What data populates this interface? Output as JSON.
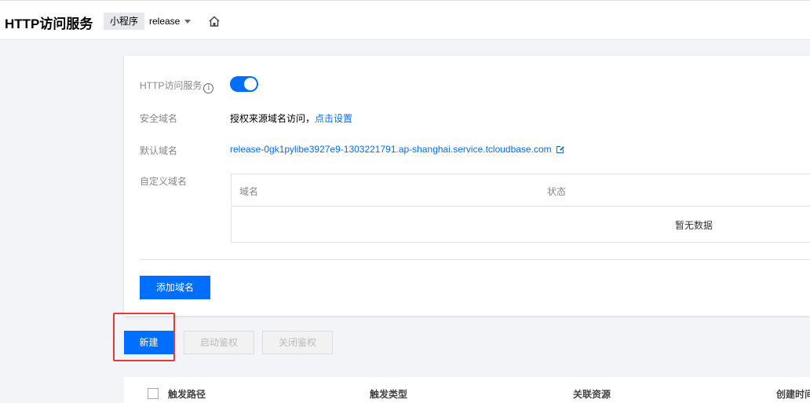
{
  "header": {
    "title": "HTTP访问服务",
    "env_tag": "小程序",
    "env_name": "release"
  },
  "settings": {
    "http_service_label": "HTTP访问服务",
    "http_service_enabled": true,
    "secure_domain_label": "安全域名",
    "secure_domain_text": "授权来源域名访问，",
    "secure_domain_link": "点击设置",
    "default_domain_label": "默认域名",
    "default_domain_value": "release-0gk1pylibe3927e9-1303221791.ap-shanghai.service.tcloudbase.com",
    "custom_domain_label": "自定义域名",
    "table_headers": [
      "域名",
      "状态"
    ],
    "empty_text": "暂无数据",
    "add_domain_button": "添加域名"
  },
  "toolbar": {
    "new_button": "新建",
    "enable_auth_button": "启动鉴权",
    "disable_auth_button": "关闭鉴权"
  },
  "list": {
    "columns": [
      "触发路径",
      "触发类型",
      "关联资源",
      "创建时间"
    ]
  },
  "colors": {
    "accent": "#006eff",
    "highlight": "#e53935"
  }
}
